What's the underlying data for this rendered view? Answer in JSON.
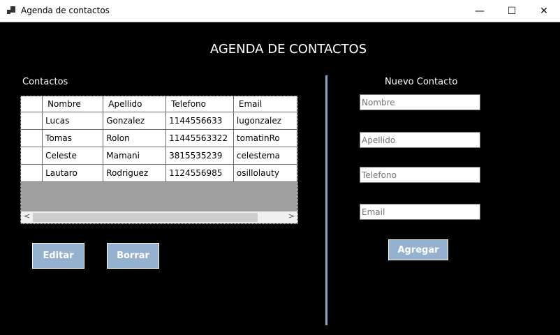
{
  "window": {
    "title": "Agenda de contactos",
    "minimize": "—",
    "maximize": "☐",
    "close": "✕"
  },
  "heading": "AGENDA DE CONTACTOS",
  "contacts": {
    "label": "Contactos",
    "columns": [
      "Nombre",
      "Apellido",
      "Telefono",
      "Email"
    ],
    "rows": [
      [
        "Lucas",
        "Gonzalez",
        "1144556633",
        "lugonzalez"
      ],
      [
        "Tomas",
        "Rolon",
        "11445563322",
        "tomatinRo"
      ],
      [
        "Celeste",
        "Mamani",
        "3815535239",
        "celestema"
      ],
      [
        "Lautaro",
        "Rodriguez",
        "1124556985",
        "osillolauty"
      ]
    ],
    "scroll_left": "<",
    "scroll_right": ">"
  },
  "buttons": {
    "edit": "Editar",
    "delete": "Borrar",
    "add": "Agregar"
  },
  "new_contact": {
    "label": "Nuevo Contacto",
    "placeholders": {
      "nombre": "Nombre",
      "apellido": "Apellido",
      "telefono": "Telefono",
      "email": "Email"
    }
  },
  "colors": {
    "button": "#95b1d0",
    "divider": "#8aa9cc"
  }
}
